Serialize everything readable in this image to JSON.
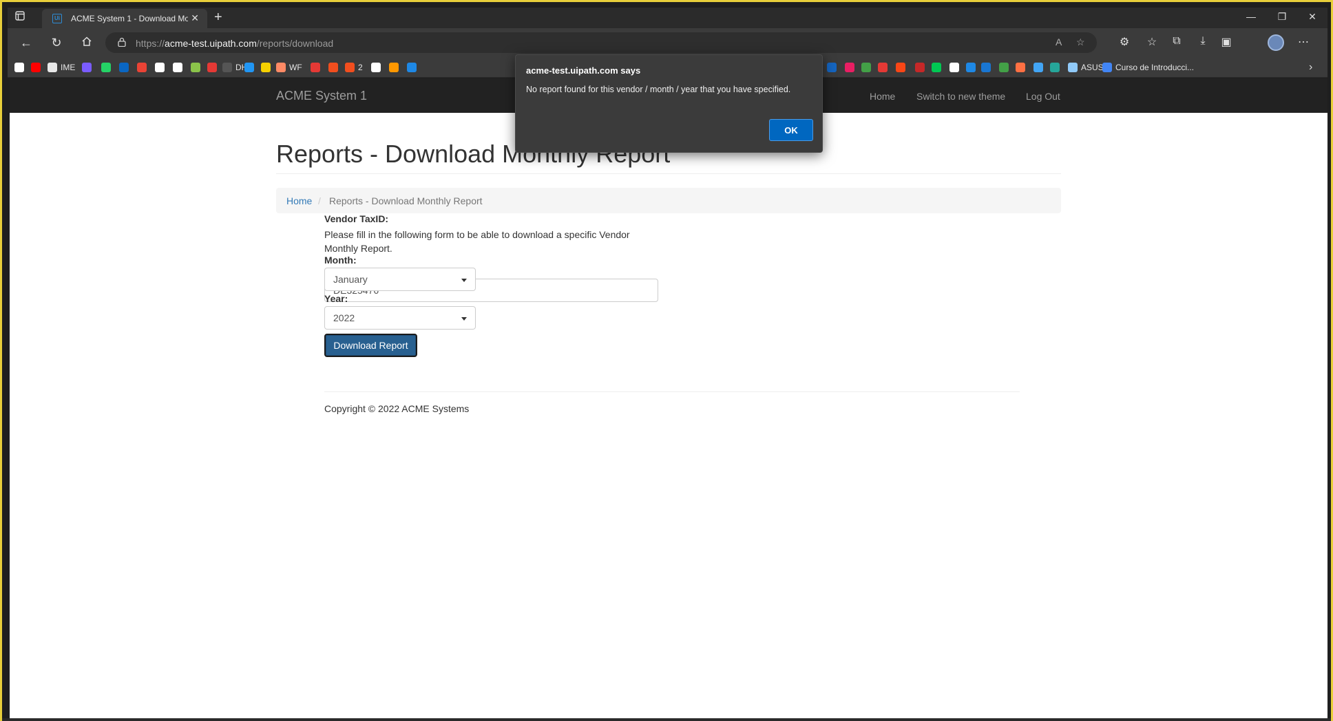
{
  "browser": {
    "tab_title": "ACME System 1 - Download Mo",
    "tab_favicon": "Ui",
    "new_tab_label": "+",
    "url_scheme": "https://",
    "url_host": "acme-test.uipath.com",
    "url_path": "/reports/download",
    "bookmarks": [
      {
        "label": "",
        "color": "#ffffff"
      },
      {
        "label": "",
        "color": "#ff0000"
      },
      {
        "label": "IME",
        "color": "#e8e8e8"
      },
      {
        "label": "",
        "color": "#7a5cff"
      },
      {
        "label": "",
        "color": "#25d366"
      },
      {
        "label": "",
        "color": "#0a66c2"
      },
      {
        "label": "",
        "color": "#ea4335"
      },
      {
        "label": "",
        "color": "#ffffff"
      },
      {
        "label": "",
        "color": "#ffffff"
      },
      {
        "label": "",
        "color": "#8bc34a"
      },
      {
        "label": "",
        "color": "#e53935"
      },
      {
        "label": "DH",
        "color": "#555555"
      },
      {
        "label": "",
        "color": "#2196f3"
      },
      {
        "label": "",
        "color": "#f5d000"
      },
      {
        "label": "WF",
        "color": "#ff8a65"
      },
      {
        "label": "",
        "color": "#e53935"
      },
      {
        "label": "",
        "color": "#f24e1e"
      },
      {
        "label": "2",
        "color": "#f24e1e"
      },
      {
        "label": "",
        "color": "#ffffff"
      },
      {
        "label": "",
        "color": "#ff9800"
      },
      {
        "label": "",
        "color": "#1e88e5"
      }
    ],
    "bookmarks_right": [
      {
        "label": "",
        "color": "#1565c0"
      },
      {
        "label": "",
        "color": "#e91e63"
      },
      {
        "label": "",
        "color": "#43a047"
      },
      {
        "label": "",
        "color": "#e53935"
      },
      {
        "label": "",
        "color": "#fa4616"
      },
      {
        "label": "",
        "color": "#c62828"
      },
      {
        "label": "",
        "color": "#00c853"
      },
      {
        "label": "",
        "color": "#ffffff"
      },
      {
        "label": "",
        "color": "#1e88e5"
      },
      {
        "label": "",
        "color": "#1976d2"
      },
      {
        "label": "",
        "color": "#43a047"
      },
      {
        "label": "",
        "color": "#ff7043"
      },
      {
        "label": "",
        "color": "#42a5f5"
      },
      {
        "label": "",
        "color": "#26a69a"
      },
      {
        "label": "ASUS",
        "color": "#90caf9"
      },
      {
        "label": "Curso de Introducci...",
        "color": "#4285f4"
      }
    ]
  },
  "app": {
    "brand": "ACME System 1",
    "nav": {
      "home": "Home",
      "switch_theme": "Switch to new theme",
      "logout": "Log Out"
    },
    "page_title": "Reports - Download Monthly Report",
    "breadcrumb": {
      "home": "Home",
      "separator": "/",
      "current": "Reports - Download Monthly Report"
    },
    "intro": "Please fill in the following form to be able to download a specific Vendor Monthly Report.",
    "form": {
      "vendor_label": "Vendor TaxID:",
      "vendor_value": "DE325476",
      "month_label": "Month:",
      "month_value": "January",
      "year_label": "Year:",
      "year_value": "2022",
      "submit_label": "Download Report"
    },
    "copyright": "Copyright © 2022 ACME Systems"
  },
  "alert": {
    "title": "acme-test.uipath.com says",
    "message": "No report found for this vendor / month / year that you have specified.",
    "ok_label": "OK"
  },
  "colors": {
    "frame_accent": "#e8cf3a",
    "primary_button": "#286090",
    "link": "#337ab7",
    "alert_ok": "#0067c0"
  }
}
